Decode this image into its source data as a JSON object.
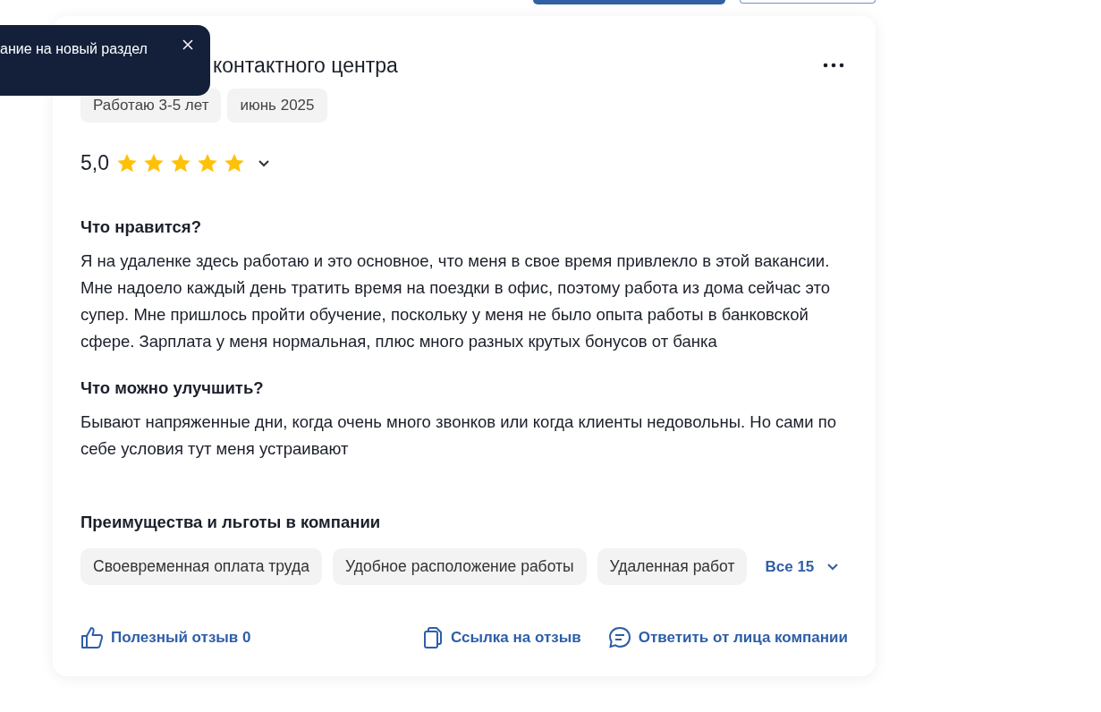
{
  "toast": {
    "text": "ание на новый раздел"
  },
  "review": {
    "title": "контактного центра",
    "tags": [
      "Работаю 3-5 лет",
      "июнь 2025"
    ],
    "rating": "5,0",
    "stars": 5,
    "sections": [
      {
        "heading": "Что нравится?",
        "text": "Я на удаленке здесь работаю и это основное, что меня в свое время привлекло в этой вакансии. Мне надоело каждый день тратить время на поездки в офис, поэтому работа из дома сейчас это супер. Мне пришлось пройти обучение, поскольку у меня не было опыта работы в банковской сфере. Зарплата у меня нормальная, плюс много разных крутых бонусов от банка"
      },
      {
        "heading": "Что можно улучшить?",
        "text": "Бывают напряженные дни, когда очень много звонков или когда клиенты недовольны. Но сами по себе условия тут меня устраивают"
      }
    ],
    "benefits": {
      "heading": "Преимущества и льготы в компании",
      "items": [
        "Своевременная оплата труда",
        "Удобное расположение работы",
        "Удаленная работ"
      ],
      "more": "Все 15"
    },
    "actions": [
      {
        "kind": "like",
        "label": "Полезный отзыв 0"
      },
      {
        "kind": "copy",
        "label": "Ссылка на отзыв"
      },
      {
        "kind": "reply",
        "label": "Ответить от лица компании"
      }
    ]
  }
}
